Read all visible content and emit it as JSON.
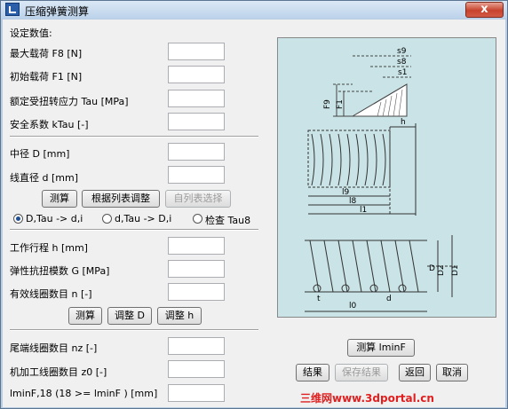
{
  "window": {
    "title": "压缩弹簧测算",
    "close_label": "x"
  },
  "section_title": "设定数值:",
  "loads": [
    {
      "label": "最大载荷 F8 [N]",
      "value": ""
    },
    {
      "label": "初始载荷 F1 [N]",
      "value": ""
    },
    {
      "label": "额定受扭转应力 Tau [MPa]",
      "value": ""
    },
    {
      "label": "安全系数 kTau [-]",
      "value": ""
    }
  ],
  "geometry": [
    {
      "label": "中径 D [mm]",
      "value": ""
    },
    {
      "label": "线直径 d [mm]",
      "value": ""
    }
  ],
  "geometry_buttons": {
    "calc": "测算",
    "adjust_by_list": "根据列表调整",
    "select_from_list": "自列表选择"
  },
  "radios": [
    {
      "label": "D,Tau -> d,i",
      "checked": true
    },
    {
      "label": "d,Tau -> D,i",
      "checked": false
    },
    {
      "label": "检查 Tau8",
      "checked": false
    }
  ],
  "working": [
    {
      "label": "工作行程 h [mm]",
      "value": ""
    },
    {
      "label": "弹性抗扭模数 G [MPa]",
      "value": ""
    },
    {
      "label": "有效线圈数目 n [-]",
      "value": ""
    }
  ],
  "working_buttons": {
    "calc": "测算",
    "adjust_D": "调整 D",
    "adjust_h": "调整 h"
  },
  "end_coils": [
    {
      "label": "尾端线圈数目 nz [-]",
      "value": ""
    },
    {
      "label": "机加工线圈数目 z0 [-]",
      "value": ""
    },
    {
      "label": "lminF,18 (18 >= lminF ) [mm]",
      "value": ""
    }
  ],
  "right_buttons": {
    "calc_lminf": "测算 lminF",
    "result": "结果",
    "save_result": "保存结果",
    "back": "返回",
    "cancel": "取消"
  },
  "diagram_labels": {
    "s9": "s9",
    "s8": "s8",
    "s1": "s1",
    "F9": "F9",
    "F8": "F8",
    "F1": "F1",
    "h": "h",
    "l9": "l9",
    "l8": "l8",
    "l1": "l1",
    "l0": "l0",
    "D2": "D2",
    "D1": "D1",
    "D": "D",
    "d": "d",
    "t": "t"
  },
  "watermark": "三维网www.3dportal.cn",
  "colors": {
    "diagram_bg": "#c9e3e6",
    "watermark": "#e02020",
    "titlebar": "#c9dcef"
  }
}
